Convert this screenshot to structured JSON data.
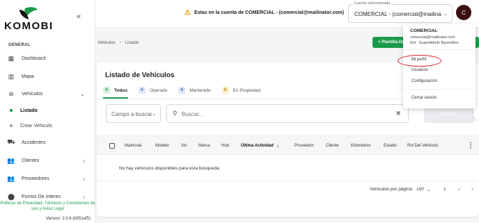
{
  "sidebar": {
    "brand": "KOMOBI",
    "section_label": "GENERAL",
    "items": [
      {
        "label": "Dashboard"
      },
      {
        "label": "Mapa"
      },
      {
        "label": "Vehículos"
      },
      {
        "label": "Accidentes"
      },
      {
        "label": "Clientes"
      },
      {
        "label": "Proveedores"
      },
      {
        "label": "Puntos De Interes"
      }
    ],
    "sub_items": [
      {
        "label": "Listado"
      },
      {
        "label": "Crear Vehiculo"
      }
    ],
    "policy_text": "Politicas de Privacidad, Términos y Condiciones de uso y Aviso Legal",
    "version": "Version: 2.0.6 (b551ef5)"
  },
  "topbar": {
    "warning": "Estas en la cuenta de COMERCIAL - (comercial@mailinator.com)",
    "account_label": "Cuenta seleccionada",
    "account_value": "COMERCIAL - (comercial@mailinator.com)",
    "avatar_letter": "C"
  },
  "breadcrumb": {
    "parent": "Vehiculos",
    "current": "Listado"
  },
  "actions": {
    "plantilla": "+ Plantilla De Vehículos"
  },
  "card": {
    "title": "Listado de Vehículos",
    "tabs": [
      {
        "count": "0",
        "label": "Todos"
      },
      {
        "count": "0",
        "label": "Operado"
      },
      {
        "count": "0",
        "label": "Mantenido"
      },
      {
        "count": "0",
        "label": "En Propiedad"
      }
    ],
    "field_select": "Campo a buscar",
    "search_placeholder": "Buscar...",
    "search_button": "Buscar",
    "columns": [
      "Matricula",
      "Modelo",
      "Vin",
      "Marca",
      "Hub",
      "Última Actividad",
      "Proveedor",
      "Cliente",
      "Kilometros",
      "Estado",
      "Rol Del Vehiculo"
    ],
    "empty_message": "No hay vehículos disponibles para esta búsqueda.",
    "pager": {
      "rows_label": "Vehículos por página:",
      "rows_value": "100",
      "page": "1"
    }
  },
  "menu": {
    "name": "COMERCIAL",
    "email": "comercial@mailinator.com",
    "rol": "Rol : SuperAdmin Backoffice",
    "items": [
      "Mi perfil",
      "Usuarios",
      "Configuración",
      "Cerrar sesión"
    ]
  },
  "colors": {
    "accent": "#1a9b4a",
    "warning": "#e6a100",
    "highlight": "#d9242c"
  }
}
